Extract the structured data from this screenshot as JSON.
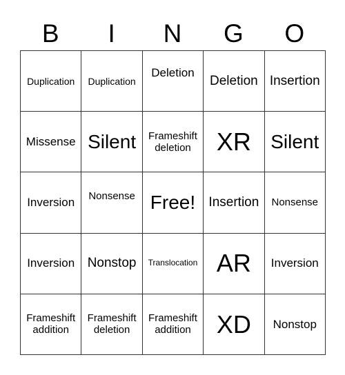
{
  "header": {
    "letters": [
      "B",
      "I",
      "N",
      "G",
      "O"
    ]
  },
  "grid": {
    "rows": [
      [
        "Duplication",
        "Duplication",
        "Deletion",
        "Deletion",
        "Insertion"
      ],
      [
        "Missense",
        "Silent",
        "Frameshift deletion",
        "XR",
        "Silent"
      ],
      [
        "Inversion",
        "Nonsense",
        "Free!",
        "Insertion",
        "Nonsense"
      ],
      [
        "Inversion",
        "Nonstop",
        "Translocation",
        "AR",
        "Inversion"
      ],
      [
        "Frameshift addition",
        "Frameshift deletion",
        "Frameshift addition",
        "XD",
        "Nonstop"
      ]
    ]
  }
}
